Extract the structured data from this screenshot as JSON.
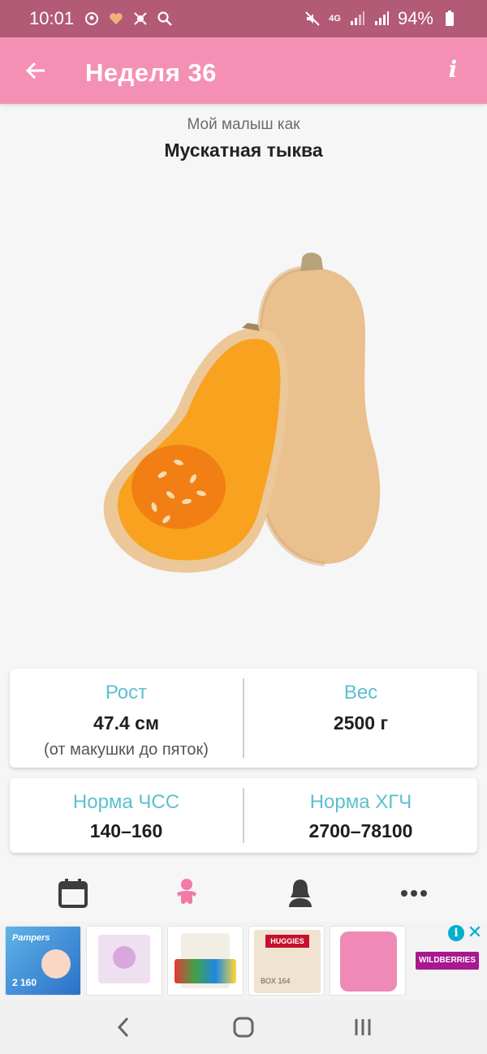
{
  "status_bar": {
    "time": "10:01",
    "battery": "94%",
    "network": "4G",
    "icons_left": [
      "baby-notification-icon",
      "heart-icon",
      "gear-bug-icon",
      "search-icon"
    ],
    "icons_right": [
      "mute-icon",
      "network-4g-icon",
      "signal-icon",
      "signal-icon",
      "battery-icon"
    ]
  },
  "app_bar": {
    "title": "Неделя 36",
    "back_icon": "back-arrow-icon",
    "info_label": "i"
  },
  "content": {
    "subtitle": "Мой малыш как",
    "fruit_name": "Мускатная тыква",
    "illustration": "butternut-squash"
  },
  "stats": {
    "height": {
      "label": "Рост",
      "value": "47.4 см",
      "note": "(от макушки до пяток)"
    },
    "weight": {
      "label": "Вес",
      "value": "2500 г"
    },
    "heart_rate": {
      "label": "Норма ЧСС",
      "value": "140–160"
    },
    "hcg": {
      "label": "Норма ХГЧ",
      "value": "2700–78100"
    }
  },
  "bottom_nav": {
    "items": [
      "calendar-icon",
      "baby-icon",
      "mother-icon",
      "more-icon"
    ],
    "active_color": "#f27aa6",
    "inactive_color": "#3d3d3d"
  },
  "ad": {
    "brand": "WILDBERRIES",
    "items": [
      {
        "label": "Pampers",
        "note": "2 160"
      },
      {
        "label": ""
      },
      {
        "label": ""
      },
      {
        "label": "HUGGIES",
        "note": "BOX 164"
      },
      {
        "label": ""
      }
    ]
  },
  "colors": {
    "status_bar": "#b35a76",
    "app_bar": "#f590b5",
    "accent_label": "#5cc0cf"
  }
}
